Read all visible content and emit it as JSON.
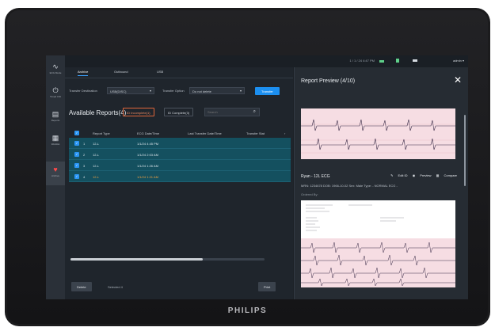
{
  "device": {
    "brand": "PHILIPS"
  },
  "status_bar": {
    "time_text": "1 / 1 / 24  4:47 PM",
    "user": "admin"
  },
  "sidebar": {
    "items": [
      {
        "label": "ECG Mode",
        "icon": "ecg-wave-icon"
      },
      {
        "label": "Timed CSI",
        "icon": "timer-icon"
      },
      {
        "label": "Reports",
        "icon": "reports-icon"
      },
      {
        "label": "Worklist",
        "icon": "worklist-icon"
      },
      {
        "label": "Archive",
        "icon": "heart-icon"
      }
    ]
  },
  "tabs": [
    "Archive",
    "Outbound",
    "USB"
  ],
  "transfer": {
    "destination_label": "Transfer Destination",
    "destination_value": "USB(DISC)",
    "option_label": "Transfer Option",
    "option_value": "Do not delete",
    "button": "Transfer"
  },
  "reports": {
    "title": "Available Reports(4)",
    "filter_incomplete": "ID Incomplete(1)",
    "filter_complete": "ID Complete(3)",
    "search_placeholder": "Search",
    "columns": [
      "Report Type",
      "ECG Date/Time",
      "Last Transfer Date/Time",
      "Transfer Stat"
    ],
    "rows": [
      {
        "num": "1",
        "type": "12-L",
        "date": "1/1/24 4:45 PM",
        "transfer": "",
        "status": ""
      },
      {
        "num": "2",
        "type": "12-L",
        "date": "1/1/24 2:03 AM",
        "transfer": "",
        "status": ""
      },
      {
        "num": "3",
        "type": "12-L",
        "date": "1/1/24 1:26 AM",
        "transfer": "",
        "status": ""
      },
      {
        "num": "4",
        "type": "12-L",
        "date": "1/1/24 1:21 AM",
        "transfer": "",
        "status": ""
      }
    ],
    "scroll_fraction": 0.68
  },
  "footer": {
    "delete_label": "Delete",
    "selected_text": "Selected 4",
    "print_label": "Print"
  },
  "preview": {
    "title": "Report Preview (4/10)",
    "patient_name": "Ryan - 12L ECG",
    "edit_label": "Edit ID",
    "preview_label": "Preview",
    "compare_label": "Compare",
    "meta": "MRN: 1234678   DOB: 1966-10-02   Sex: Male   Type: - NORMAL ECG -",
    "sub": "Ordered By:"
  },
  "colors": {
    "accent": "#1c8ff0",
    "row_selected": "#14505f",
    "filter_active": "#e0663a",
    "ecg_paper": "#f6dde3",
    "ecg_trace": "#3a2c48"
  }
}
